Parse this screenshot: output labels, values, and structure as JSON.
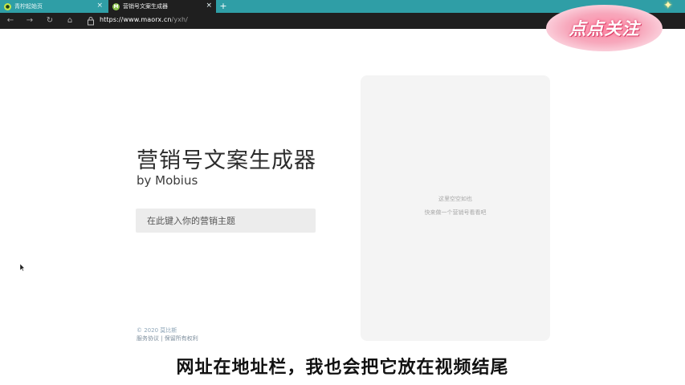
{
  "browser": {
    "tabs": [
      {
        "label": "青柠起始页",
        "favicon": "lime-circle-icon",
        "active": false
      },
      {
        "label": "营销号文案生成器",
        "favicon": "M",
        "active": true
      }
    ],
    "new_tab": "+",
    "address": {
      "scheme_host": "https://www.maorx.cn",
      "path": "/yxh/"
    }
  },
  "overlay": {
    "follow_badge": "点点关注"
  },
  "main": {
    "title": "营销号文案生成器",
    "byline": "by Mobius",
    "topic_placeholder": "在此键入你的营销主题",
    "preview": {
      "line1": "这里空空如也",
      "line2": "快来做一个营销号看看吧"
    },
    "footer": {
      "copyright": "© 2020 莫比斯",
      "links": "服务协议 | 保留所有权利"
    }
  },
  "video_subtitle": "网址在地址栏，我也会把它放在视频结尾",
  "colors": {
    "tabbar": "#2f9ea6",
    "toolbar": "#1f1f1f",
    "preview_bg": "#f4f4f4",
    "badge": "#ff8aa6"
  }
}
